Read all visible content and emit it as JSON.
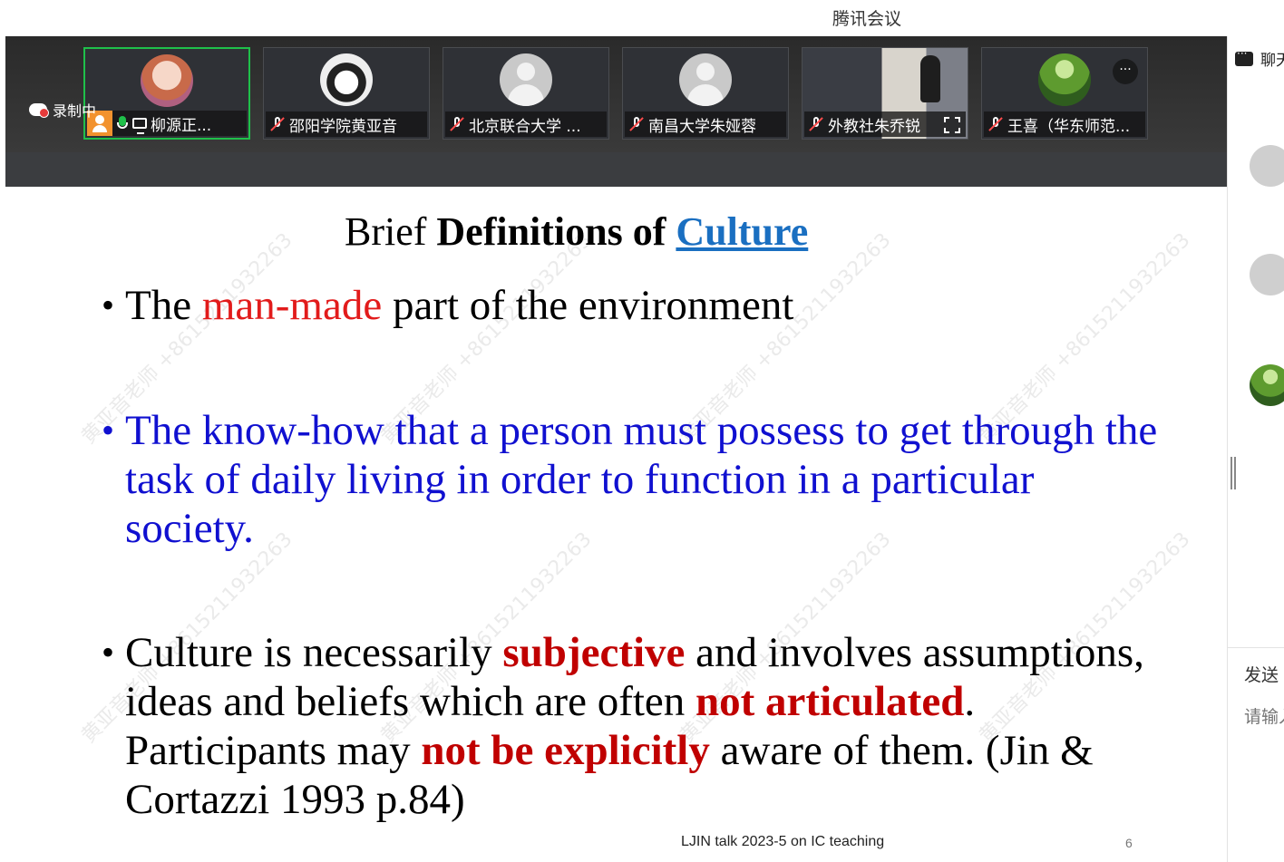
{
  "window": {
    "title": "腾讯会议"
  },
  "recording": {
    "label": "录制中"
  },
  "participants": [
    {
      "name": "柳源正...",
      "avatar": "anime-avatar",
      "mic": "on",
      "sharing": true,
      "host": true
    },
    {
      "name": "邵阳学院黄亚音",
      "avatar": "penguin-avatar",
      "mic": "muted"
    },
    {
      "name": "北京联合大学 ...",
      "avatar": "default-avatar",
      "mic": "muted"
    },
    {
      "name": "南昌大学朱娅蓉",
      "avatar": "default-avatar",
      "mic": "muted"
    },
    {
      "name": "外教社朱乔锐",
      "avatar": "camera-video",
      "mic": "muted"
    },
    {
      "name": "王喜（华东师范...",
      "avatar": "forest-avatar",
      "mic": "muted",
      "more": "···"
    }
  ],
  "slide": {
    "title": {
      "part1": "Brief ",
      "part2": "Definitions of ",
      "part3": "Culture"
    },
    "bullets": {
      "b1": {
        "t1": "The ",
        "t2": "man-made",
        "t3": " part of the environment"
      },
      "b2": {
        "t1": "The know-how that a person must possess to get through the task of daily living in order to function in a particular society."
      },
      "b3": {
        "t1": "Culture is necessarily ",
        "t2": "subjective",
        "t3": " and involves assumptions, ideas and beliefs which are often ",
        "t4": "not articulated",
        "t5": ". Participants may ",
        "t6": "not be explicitly",
        "t7": " aware of them. (Jin & Cortazzi 1993 p.84)"
      }
    },
    "footer": "LJIN talk 2023-5 on IC teaching",
    "page_number": "6",
    "watermark": "黄亚音老师 +8615211932263"
  },
  "chat": {
    "header": "聊天",
    "send_label": "发送",
    "input_placeholder": "请输入"
  },
  "colors": {
    "accent_blue": "#1a6fc1",
    "bullet_blue": "#1010d0",
    "red": "#e21b1b",
    "dark_red": "#c00000",
    "active_green": "#1fc04a"
  }
}
